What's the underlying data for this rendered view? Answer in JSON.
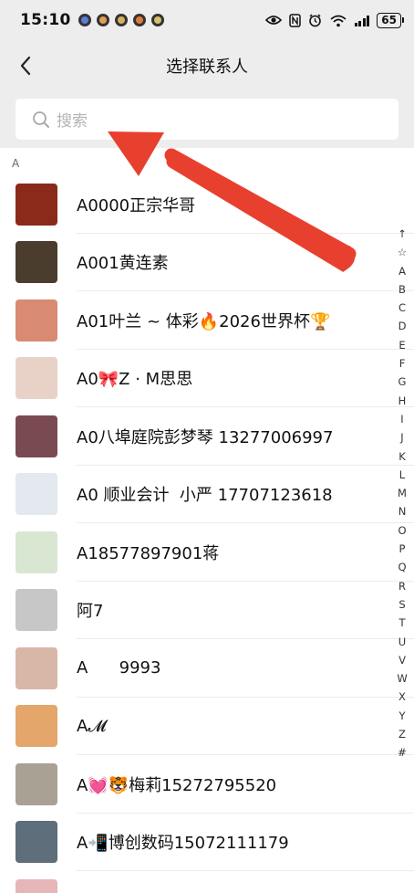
{
  "status_bar": {
    "time": "15:10",
    "notification_icons": [
      "app-notification-icon",
      "app-notification-icon",
      "app-notification-icon",
      "app-notification-icon",
      "app-notification-icon"
    ],
    "system_icons": [
      "eye-icon",
      "nfc-icon",
      "alarm-icon",
      "wifi-icon",
      "signal-icon"
    ],
    "wifi_label": "6",
    "battery": "65"
  },
  "nav": {
    "title": "选择联系人",
    "back_icon": "chevron-left-icon"
  },
  "search": {
    "placeholder": "搜索",
    "icon": "search-icon"
  },
  "section": {
    "letter": "A"
  },
  "contacts": [
    {
      "name": "A0000正宗华哥",
      "avatar_color": "#8a2a1a"
    },
    {
      "name": "A001黄连素",
      "avatar_color": "#4a3d2e"
    },
    {
      "name": "A01叶兰 ~ 体彩🔥2026世界杯🏆",
      "avatar_color": "#d98a72"
    },
    {
      "name": "A0🎀Z · M思思",
      "avatar_color": "#e8d2c8"
    },
    {
      "name": "A0八埠庭院彭梦琴 13277006997",
      "avatar_color": "#7a4a52"
    },
    {
      "name": "A0 顺业会计  小严 17707123618",
      "avatar_color": "#e4e8ef"
    },
    {
      "name": "A18577897901蒋",
      "avatar_color": "#d8e6d2"
    },
    {
      "name": "阿7",
      "avatar_color": "#c7c7c7"
    },
    {
      "name": "A      9993",
      "avatar_color": "#d9b7a8"
    },
    {
      "name": "A𝓜",
      "avatar_color": "#e4a66a"
    },
    {
      "name": "A💓🐯梅莉15272795520",
      "avatar_color": "#a9a193"
    },
    {
      "name": "A📲博创数码15072111179",
      "avatar_color": "#5e6e7a"
    },
    {
      "name": "",
      "avatar_color": "#e6b6b8"
    }
  ],
  "index_letters": [
    "↑",
    "☆",
    "A",
    "B",
    "C",
    "D",
    "E",
    "F",
    "G",
    "H",
    "I",
    "J",
    "K",
    "L",
    "M",
    "N",
    "O",
    "P",
    "Q",
    "R",
    "S",
    "T",
    "U",
    "V",
    "W",
    "X",
    "Y",
    "Z",
    "#"
  ],
  "colors": {
    "header_bg": "#ededed",
    "annotation_arrow": "#e8402f"
  }
}
